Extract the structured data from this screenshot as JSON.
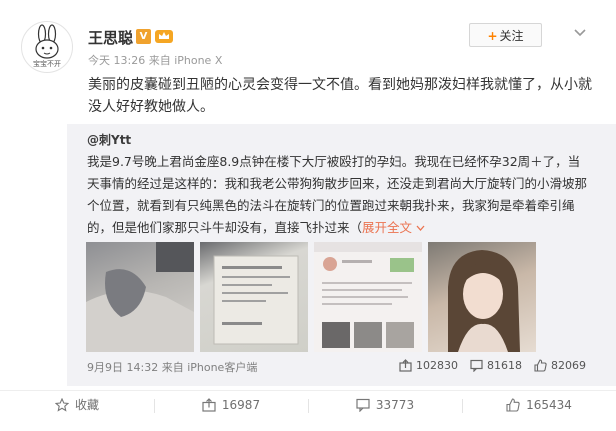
{
  "author": {
    "name": "王思聪",
    "verified_badge": "V",
    "avatar_caption": "宝宝不开",
    "timestamp": "今天 13:26",
    "source": "来自 iPhone X"
  },
  "follow_label": "关注",
  "post_text": "美丽的皮囊碰到丑陋的心灵会变得一文不值。看到她妈那泼妇样我就懂了，从小就没人好好教她做人。",
  "repost": {
    "author": "@刺Ytt",
    "text": "我是9.7号晚上君尚金座8.9点钟在楼下大厅被殴打的孕妇。我现在已经怀孕32周＋了，当天事情的经过是这样的：我和我老公带狗狗散步回来，还没走到君尚大厅旋转门的小滑坡那个位置，就看到有只纯黑色的法斗在旋转门的位置跑过来朝我扑来，我家狗是牵着牵引绳的，但是他们家那只斗牛却没有，直接飞扑过来（",
    "expand_label": "展开全文",
    "timestamp": "9月9日 14:32",
    "source": "来自 iPhone客户端",
    "reposts": "102830",
    "comments": "81618",
    "likes": "82069"
  },
  "actions": {
    "favorite": "收藏",
    "repost": "16987",
    "comment": "33773",
    "like": "165434"
  },
  "colors": {
    "accent": "#ff8200",
    "link": "#eb7350",
    "repost_bg": "#f2f2f5"
  }
}
